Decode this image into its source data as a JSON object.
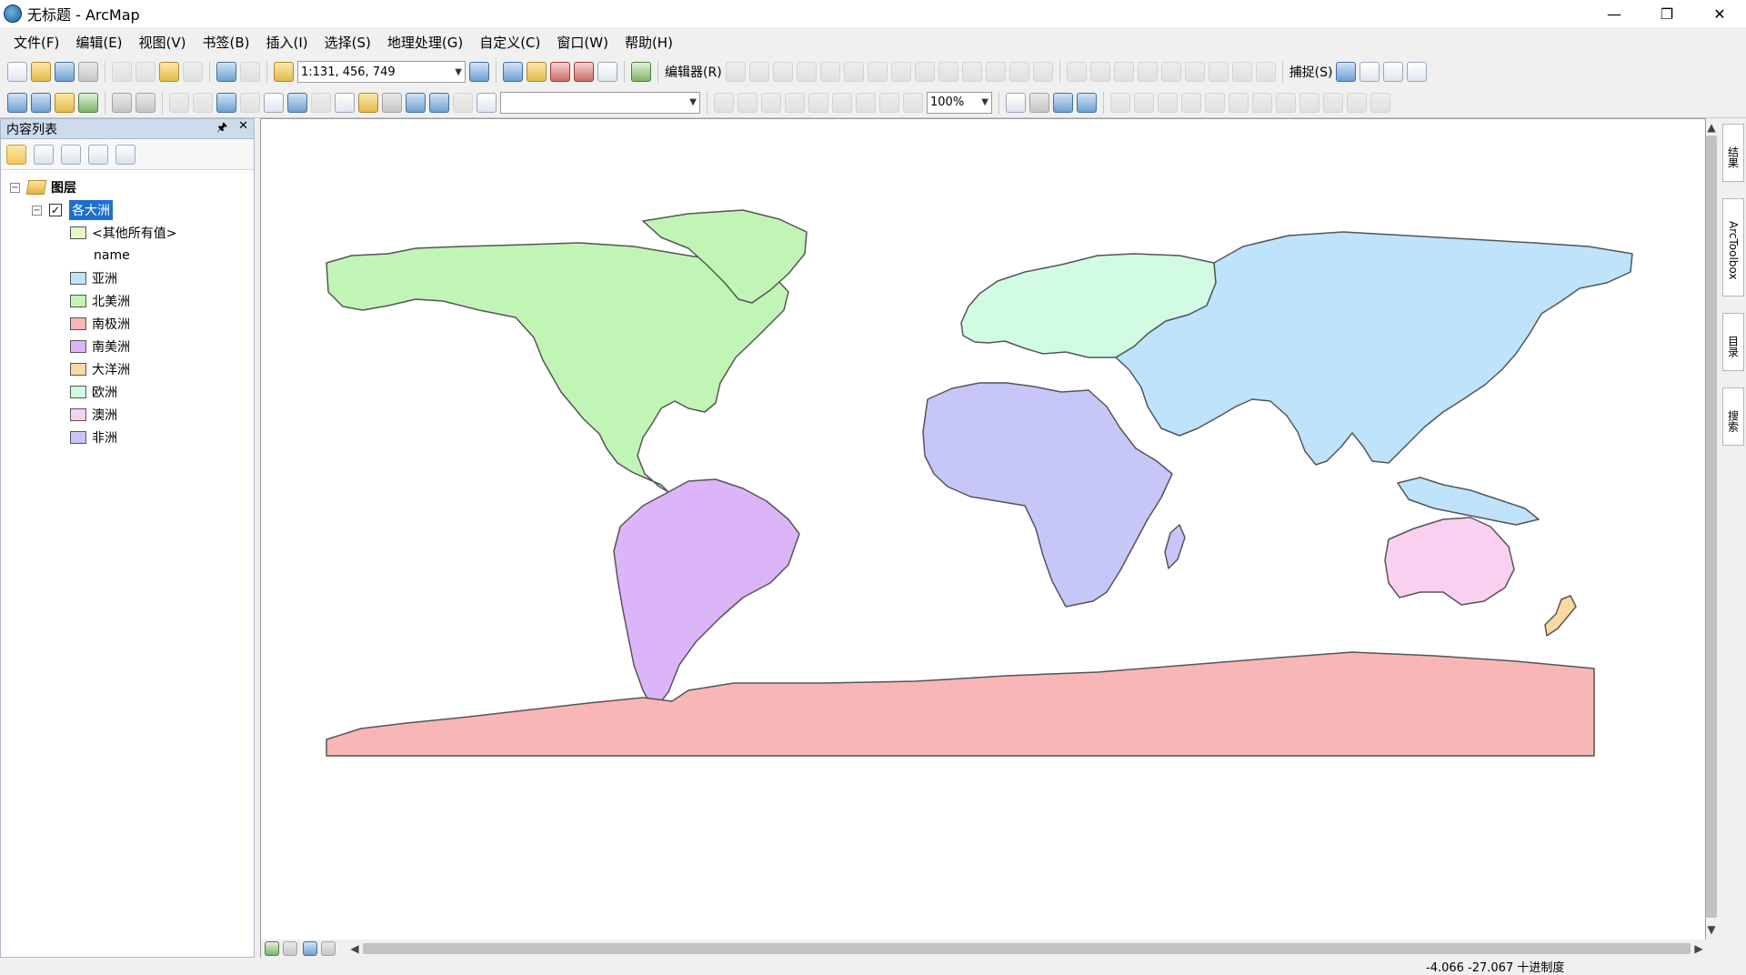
{
  "window": {
    "title": "无标题 - ArcMap",
    "minimize": "—",
    "restore": "❐",
    "close": "✕"
  },
  "menu": [
    "文件(F)",
    "编辑(E)",
    "视图(V)",
    "书签(B)",
    "插入(I)",
    "选择(S)",
    "地理处理(G)",
    "自定义(C)",
    "窗口(W)",
    "帮助(H)"
  ],
  "toolbar": {
    "scale_value": "1:131, 456, 749",
    "editor_label": "编辑器(R)",
    "snapping_label": "捕捉(S)",
    "zoom_value": "100%"
  },
  "toc": {
    "title": "内容列表",
    "pin": "🖈",
    "close": "✕",
    "root_label": "图层",
    "layer_label": "各大洲",
    "layer_checked": "✓",
    "other_values_label": "<其他所有值>",
    "field_label": "name",
    "legend": [
      {
        "label": "亚洲",
        "color": "#bee3fb"
      },
      {
        "label": "北美洲",
        "color": "#c1f5b5"
      },
      {
        "label": "南极洲",
        "color": "#f9b6b6"
      },
      {
        "label": "南美洲",
        "color": "#dcb4f8"
      },
      {
        "label": "大洋洲",
        "color": "#fbd9a3"
      },
      {
        "label": "欧洲",
        "color": "#d2fbe4"
      },
      {
        "label": "澳洲",
        "color": "#fad0f0"
      },
      {
        "label": "非洲",
        "color": "#c7c6f9"
      }
    ],
    "other_color": "#e5f7c3"
  },
  "right_tabs": [
    "结果",
    "ArcToolbox",
    "目录",
    "搜索"
  ],
  "status": {
    "coordinates": "-4.066  -27.067 十进制度"
  }
}
